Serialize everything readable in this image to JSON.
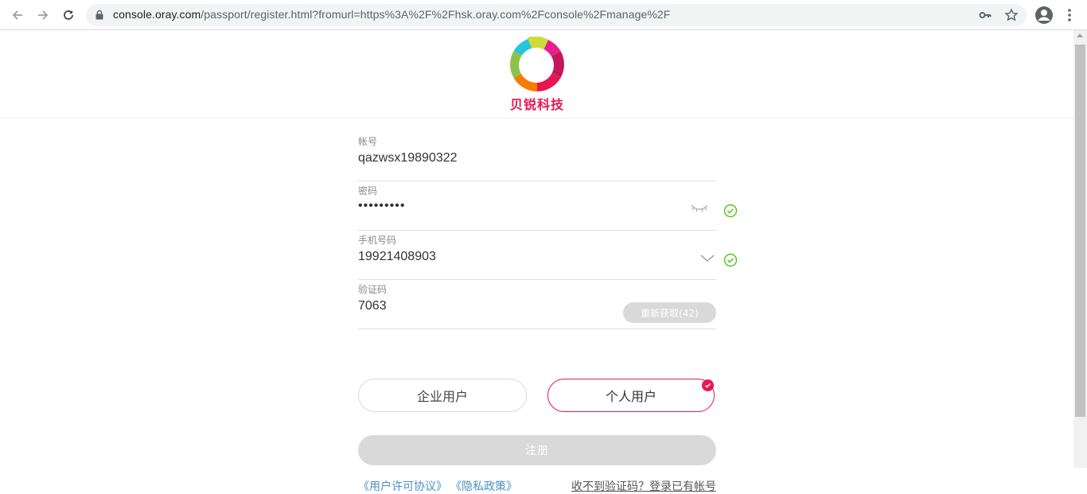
{
  "browser": {
    "url_host": "console.oray.com",
    "url_rest": "/passport/register.html?fromurl=https%3A%2F%2Fhsk.oray.com%2Fconsole%2Fmanage%2F"
  },
  "header": {
    "brand": "贝锐科技"
  },
  "form": {
    "account": {
      "label": "帐号",
      "value": "qazwsx19890322"
    },
    "password": {
      "label": "密码",
      "value": "•••••••••"
    },
    "phone": {
      "label": "手机号码",
      "value": "19921408903"
    },
    "code": {
      "label": "验证码",
      "value": "7063",
      "resend_label": "重新获取(42)"
    }
  },
  "user_type": {
    "enterprise_label": "企业用户",
    "personal_label": "个人用户",
    "selected": "personal"
  },
  "submit_label": "注册",
  "links": {
    "license": "《用户许可协议》",
    "privacy": "《隐私政策》",
    "right": "收不到验证码？登录已有帐号"
  },
  "colors": {
    "brand": "#e8174f",
    "success": "#52c41a",
    "link": "#4a90c2"
  }
}
